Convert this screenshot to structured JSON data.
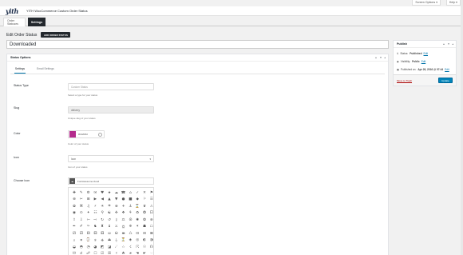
{
  "topbar": {
    "screen_options": "Screen Options ▾",
    "help": "Help ▾"
  },
  "header": {
    "logo": "yith",
    "title": "YITH WooCommerce Custom Order Status"
  },
  "nav_tabs": [
    "Order Statuses",
    "Settings"
  ],
  "page": {
    "heading": "Edit Order Status",
    "add_new": "ADD ORDER STATUS"
  },
  "title_value": "Downloaded",
  "status_options": {
    "title": "Status Options",
    "tabs": [
      "Settings",
      "Email Settings"
    ],
    "status_type": {
      "label": "Status Type",
      "placeholder": "Custom Status",
      "desc": "Select a type for your status"
    },
    "slug": {
      "label": "Slug",
      "value": "delivery",
      "desc": "Unique slug of your status"
    },
    "color": {
      "label": "Color",
      "value": "#b42b8d",
      "desc": "Color of your status"
    },
    "icon": {
      "label": "Icon",
      "value": "Icon",
      "desc": "Icon of your status"
    },
    "choose_icon": {
      "label": "Choose Icon",
      "value": "FontAwesome:cloud"
    },
    "icon_glyphs": [
      "✚",
      "✎",
      "⚙",
      "✉",
      "♥",
      "★",
      "☁",
      "☎",
      "⌂",
      "✓",
      "✕",
      "⚑",
      "⊕",
      "✂",
      "⊞",
      "▶",
      "◀",
      "▲",
      "▼",
      "●",
      "■",
      "◆",
      "⚐",
      "☰",
      "✿",
      "⌘",
      "♫",
      "⚡",
      "☀",
      "☂",
      "⊗",
      "✈",
      "⚓",
      "⌛",
      "♛",
      "⚠",
      "◉",
      "⊙",
      "✦",
      "☷",
      "⚲",
      "☯",
      "✜",
      "❖",
      "⚘",
      "♻",
      "✪",
      "⚀",
      "⇧",
      "⇩",
      "⇦",
      "⇨",
      "↻",
      "↺",
      "⚷",
      "⚖",
      "☮",
      "✺",
      "❂",
      "⊛",
      "✒",
      "✐",
      "✑",
      "♞",
      "♜",
      "♝",
      "⚔",
      "⛭",
      "✵",
      "✶",
      "☗",
      "☖",
      "⚁",
      "⚂",
      "⚃",
      "⚄",
      "⚅",
      "⛀",
      "⛁",
      "⛂",
      "♺",
      "⊡",
      "⊟",
      "⊠",
      "⌕",
      "⌗",
      "⌚",
      "⍟",
      "⎈",
      "⏏",
      "⏚",
      "⏳",
      "◈",
      "◎",
      "◐",
      "◑",
      "◒",
      "◓",
      "◔",
      "◕",
      "◩",
      "◪",
      "☄",
      "☆",
      "☇",
      "☈",
      "☉",
      "☊",
      "☋",
      "☌",
      "☍",
      "☐",
      "☑",
      "☒",
      "☓",
      "☘",
      "☙",
      "☚",
      "☛",
      "☜"
    ]
  },
  "publish": {
    "title": "Publish",
    "status_label": "Status:",
    "status_value": "Published",
    "status_edit": "Edit",
    "visibility_label": "Visibility:",
    "visibility_value": "Public",
    "visibility_edit": "Edit",
    "published_label": "Published on:",
    "published_value": "Apr 26, 2016 @ 07:44",
    "published_edit": "Edit",
    "trash": "Move to Trash",
    "update": "Update"
  }
}
